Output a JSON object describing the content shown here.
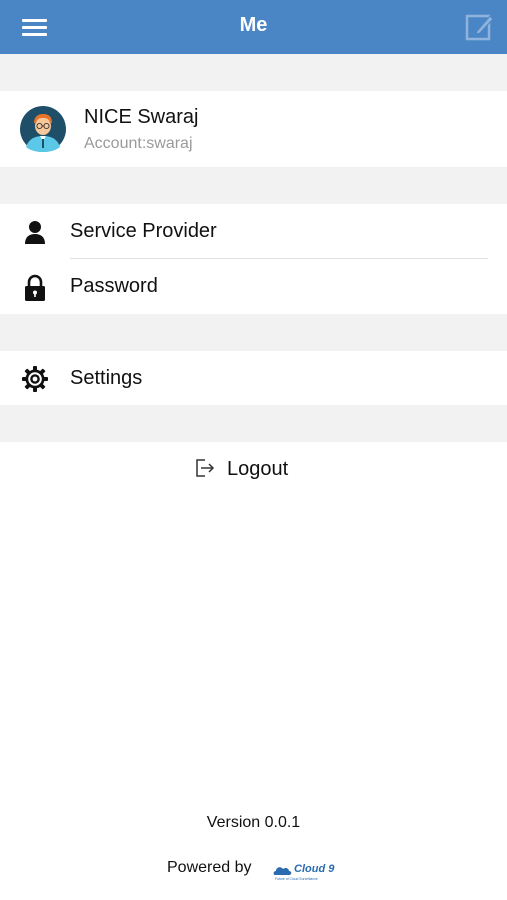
{
  "header": {
    "title": "Me",
    "menu_icon": "hamburger-menu-icon",
    "edit_icon": "edit-icon",
    "background_color": "#4a86c5"
  },
  "profile": {
    "name": "NICE Swaraj",
    "account": "Account:swaraj",
    "avatar_icon": "avatar-icon"
  },
  "menu": {
    "service_provider": {
      "label": "Service Provider",
      "icon": "person-icon"
    },
    "password": {
      "label": "Password",
      "icon": "lock-icon"
    },
    "settings": {
      "label": "Settings",
      "icon": "gear-icon"
    }
  },
  "logout": {
    "label": "Logout",
    "icon": "logout-icon"
  },
  "footer": {
    "version": "Version 0.0.1",
    "powered_by": "Powered by",
    "logo_text": "Cloud 9",
    "logo_tagline": "Future of Cloud Surveillance"
  }
}
